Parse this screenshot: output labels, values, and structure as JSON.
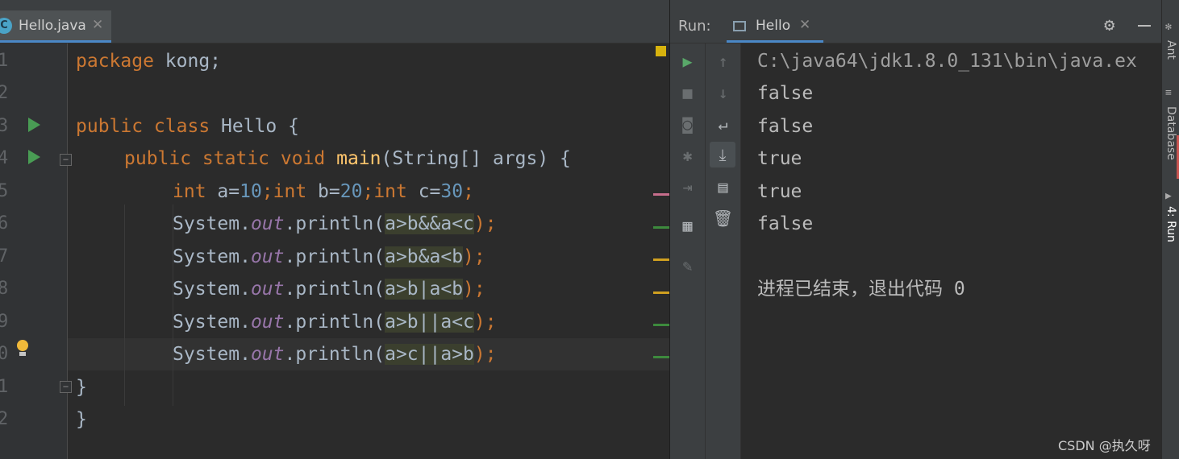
{
  "editor": {
    "tab": {
      "icon": "C",
      "filename": "Hello.java",
      "close": "✕"
    },
    "line_numbers": [
      "1",
      "2",
      "3",
      "4",
      "5",
      "6",
      "7",
      "8",
      "9",
      "0",
      "1",
      "2"
    ],
    "code": {
      "l1": {
        "kw": "package",
        "rest": " kong;"
      },
      "l3": {
        "kw": "public class",
        "rest": " Hello {"
      },
      "l4": {
        "kw": "public static void",
        "fn": "main",
        "rest": "(String[] args) {"
      },
      "l5": {
        "t1": "int",
        "t2": " a=",
        "n1": "10",
        "t3": ";",
        "t4": "int",
        "t5": " b=",
        "n2": "20",
        "t6": ";",
        "t7": "int",
        "t8": " c=",
        "n3": "30",
        "t9": ";"
      },
      "println_lines": [
        {
          "pre": "System.",
          "out": "out",
          "call": ".println(",
          "expr": "a>b&&a<c",
          "end": ");"
        },
        {
          "pre": "System.",
          "out": "out",
          "call": ".println(",
          "expr": "a>b&a<b",
          "end": ");"
        },
        {
          "pre": "System.",
          "out": "out",
          "call": ".println(",
          "expr": "a>b|a<b",
          "end": ");"
        },
        {
          "pre": "System.",
          "out": "out",
          "call": ".println(",
          "expr": "a>b||a<c",
          "end": ");"
        },
        {
          "pre": "System.",
          "out": "out",
          "call": ".println(",
          "expr": "a>c||a>b",
          "end": ");"
        }
      ],
      "l11": "}",
      "l12": "}"
    }
  },
  "run_panel": {
    "label": "Run:",
    "tab": {
      "name": "Hello",
      "close": "✕"
    },
    "output": [
      "C:\\java64\\jdk1.8.0_131\\bin\\java.ex",
      "false",
      "false",
      "true",
      "true",
      "false"
    ],
    "exit_message": "进程已结束，退出代码 0"
  },
  "tool_strip": {
    "ant": "Ant",
    "database": "Database",
    "run": "4: Run"
  },
  "watermark": "CSDN @执久呀",
  "colors": {
    "keyword": "#cc7832",
    "number": "#6897bb",
    "method": "#ffc66d",
    "field": "#9876aa",
    "run_green": "#499c54",
    "accent": "#4a88c7"
  }
}
